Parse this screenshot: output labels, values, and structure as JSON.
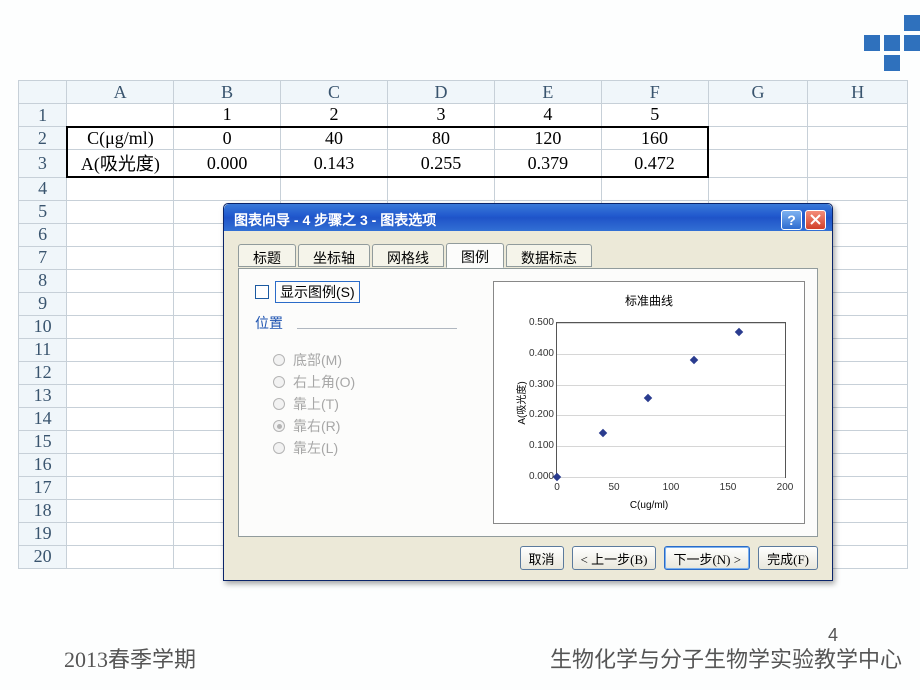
{
  "sheet": {
    "columns": [
      "A",
      "B",
      "C",
      "D",
      "E",
      "F",
      "G",
      "H"
    ],
    "rows": [
      {
        "num": "1",
        "cells": [
          "",
          "1",
          "2",
          "3",
          "4",
          "5",
          "",
          ""
        ]
      },
      {
        "num": "2",
        "cells": [
          "C(μg/ml)",
          "0",
          "40",
          "80",
          "120",
          "160",
          "",
          ""
        ]
      },
      {
        "num": "3",
        "cells": [
          "A(吸光度)",
          "0.000",
          "0.143",
          "0.255",
          "0.379",
          "0.472",
          "",
          ""
        ]
      },
      {
        "num": "4",
        "cells": [
          "",
          "",
          "",
          "",
          "",
          "",
          "",
          ""
        ]
      },
      {
        "num": "5",
        "cells": [
          "",
          "",
          "",
          "",
          "",
          "",
          "",
          ""
        ]
      },
      {
        "num": "6",
        "cells": [
          "",
          "",
          "",
          "",
          "",
          "",
          "",
          ""
        ]
      },
      {
        "num": "7",
        "cells": [
          "",
          "",
          "",
          "",
          "",
          "",
          "",
          ""
        ]
      },
      {
        "num": "8",
        "cells": [
          "",
          "",
          "",
          "",
          "",
          "",
          "",
          ""
        ]
      },
      {
        "num": "9",
        "cells": [
          "",
          "",
          "",
          "",
          "",
          "",
          "",
          ""
        ]
      },
      {
        "num": "10",
        "cells": [
          "",
          "",
          "",
          "",
          "",
          "",
          "",
          ""
        ]
      },
      {
        "num": "11",
        "cells": [
          "",
          "",
          "",
          "",
          "",
          "",
          "",
          ""
        ]
      },
      {
        "num": "12",
        "cells": [
          "",
          "",
          "",
          "",
          "",
          "",
          "",
          ""
        ]
      },
      {
        "num": "13",
        "cells": [
          "",
          "",
          "",
          "",
          "",
          "",
          "",
          ""
        ]
      },
      {
        "num": "14",
        "cells": [
          "",
          "",
          "",
          "",
          "",
          "",
          "",
          ""
        ]
      },
      {
        "num": "15",
        "cells": [
          "",
          "",
          "",
          "",
          "",
          "",
          "",
          ""
        ]
      },
      {
        "num": "16",
        "cells": [
          "",
          "",
          "",
          "",
          "",
          "",
          "",
          ""
        ]
      },
      {
        "num": "17",
        "cells": [
          "",
          "",
          "",
          "",
          "",
          "",
          "",
          ""
        ]
      },
      {
        "num": "18",
        "cells": [
          "",
          "",
          "",
          "",
          "",
          "",
          "",
          ""
        ]
      },
      {
        "num": "19",
        "cells": [
          "",
          "",
          "",
          "",
          "",
          "",
          "",
          ""
        ]
      },
      {
        "num": "20",
        "cells": [
          "",
          "",
          "",
          "",
          "",
          "",
          "",
          ""
        ]
      }
    ]
  },
  "dialog": {
    "title": "图表向导 - 4 步骤之 3 - 图表选项",
    "tabs": {
      "t0": "标题",
      "t1": "坐标轴",
      "t2": "网格线",
      "t3": "图例",
      "t4": "数据标志"
    },
    "show_legend_label": "显示图例(S)",
    "position_label": "位置",
    "radios": {
      "r0": "底部(M)",
      "r1": "右上角(O)",
      "r2": "靠上(T)",
      "r3": "靠右(R)",
      "r4": "靠左(L)"
    },
    "buttons": {
      "cancel": "取消",
      "back": "< 上一步(B)",
      "next": "下一步(N) >",
      "finish": "完成(F)"
    }
  },
  "chart_data": {
    "type": "scatter",
    "title": "标准曲线",
    "xlabel": "C(ug/ml)",
    "ylabel": "A(吸光度)",
    "xlim": [
      0,
      200
    ],
    "ylim": [
      0,
      0.5
    ],
    "xticks": [
      0,
      50,
      100,
      150,
      200
    ],
    "yticks": [
      0.0,
      0.1,
      0.2,
      0.3,
      0.4,
      0.5
    ],
    "x": [
      0,
      40,
      80,
      120,
      160
    ],
    "y": [
      0.0,
      0.143,
      0.255,
      0.379,
      0.472
    ]
  },
  "footer": {
    "left": "2013春季学期",
    "right": "生物化学与分子生物学实验教学中心",
    "page": "4"
  }
}
